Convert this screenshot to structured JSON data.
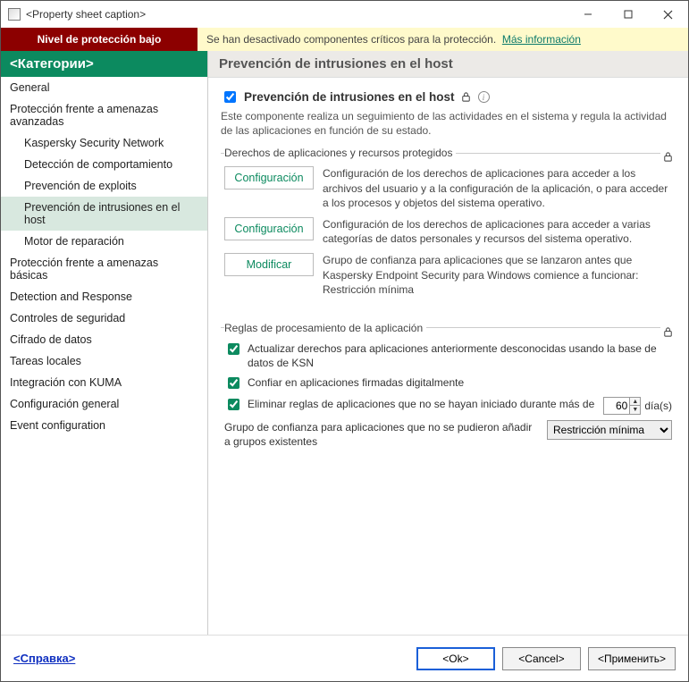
{
  "window": {
    "title": "<Property sheet caption>"
  },
  "alert": {
    "badge": "Nivel de protección bajo",
    "message": "Se han desactivado componentes críticos para la protección.",
    "link": "Más información"
  },
  "sidebar": {
    "header": "<Категории>",
    "items": [
      {
        "label": "General",
        "sub": false,
        "selected": false
      },
      {
        "label": "Protección frente a amenazas avanzadas",
        "sub": false,
        "selected": false
      },
      {
        "label": "Kaspersky Security Network",
        "sub": true,
        "selected": false
      },
      {
        "label": "Detección de comportamiento",
        "sub": true,
        "selected": false
      },
      {
        "label": "Prevención de exploits",
        "sub": true,
        "selected": false
      },
      {
        "label": "Prevención de intrusiones en el host",
        "sub": true,
        "selected": true
      },
      {
        "label": "Motor de reparación",
        "sub": true,
        "selected": false
      },
      {
        "label": "Protección frente a amenazas básicas",
        "sub": false,
        "selected": false
      },
      {
        "label": "Detection and Response",
        "sub": false,
        "selected": false
      },
      {
        "label": "Controles de seguridad",
        "sub": false,
        "selected": false
      },
      {
        "label": "Cifrado de datos",
        "sub": false,
        "selected": false
      },
      {
        "label": "Tareas locales",
        "sub": false,
        "selected": false
      },
      {
        "label": "Integración con KUMA",
        "sub": false,
        "selected": false
      },
      {
        "label": "Configuración general",
        "sub": false,
        "selected": false
      },
      {
        "label": "Event configuration",
        "sub": false,
        "selected": false
      }
    ]
  },
  "main": {
    "header": "Prevención de intrusiones en el host",
    "enable_label": "Prevención de intrusiones en el host",
    "enable_checked": true,
    "description": "Este componente realiza un seguimiento de las actividades en el sistema y regula la actividad de las aplicaciones en función de su estado.",
    "group1": {
      "legend": "Derechos de aplicaciones y recursos protegidos",
      "rows": [
        {
          "button": "Configuración",
          "text": "Configuración de los derechos de aplicaciones para acceder a los archivos del usuario y a la configuración de la aplicación, o para acceder a los procesos y objetos del sistema operativo."
        },
        {
          "button": "Configuración",
          "text": "Configuración de los derechos de aplicaciones para acceder a varias categorías de datos personales y recursos del sistema operativo."
        },
        {
          "button": "Modificar",
          "text": "Grupo de confianza para aplicaciones que se lanzaron antes que Kaspersky Endpoint Security para Windows comience a funcionar: Restricción mínima"
        }
      ]
    },
    "group2": {
      "legend": "Reglas de procesamiento de la aplicación",
      "rule1": {
        "checked": true,
        "text": "Actualizar derechos para aplicaciones anteriormente desconocidas usando la base de datos de KSN"
      },
      "rule2": {
        "checked": true,
        "text": "Confiar en aplicaciones firmadas digitalmente"
      },
      "rule3": {
        "checked": true,
        "text": "Eliminar reglas de aplicaciones que no se hayan iniciado durante más de",
        "value": "60",
        "unit": "día(s)"
      },
      "rule4": {
        "text": "Grupo de confianza para aplicaciones que no se pudieron añadir a grupos existentes",
        "selected": "Restricción mínima"
      }
    }
  },
  "footer": {
    "help": "<Справка>",
    "ok": "<Ok>",
    "cancel": "<Cancel>",
    "apply": "<Применить>"
  }
}
